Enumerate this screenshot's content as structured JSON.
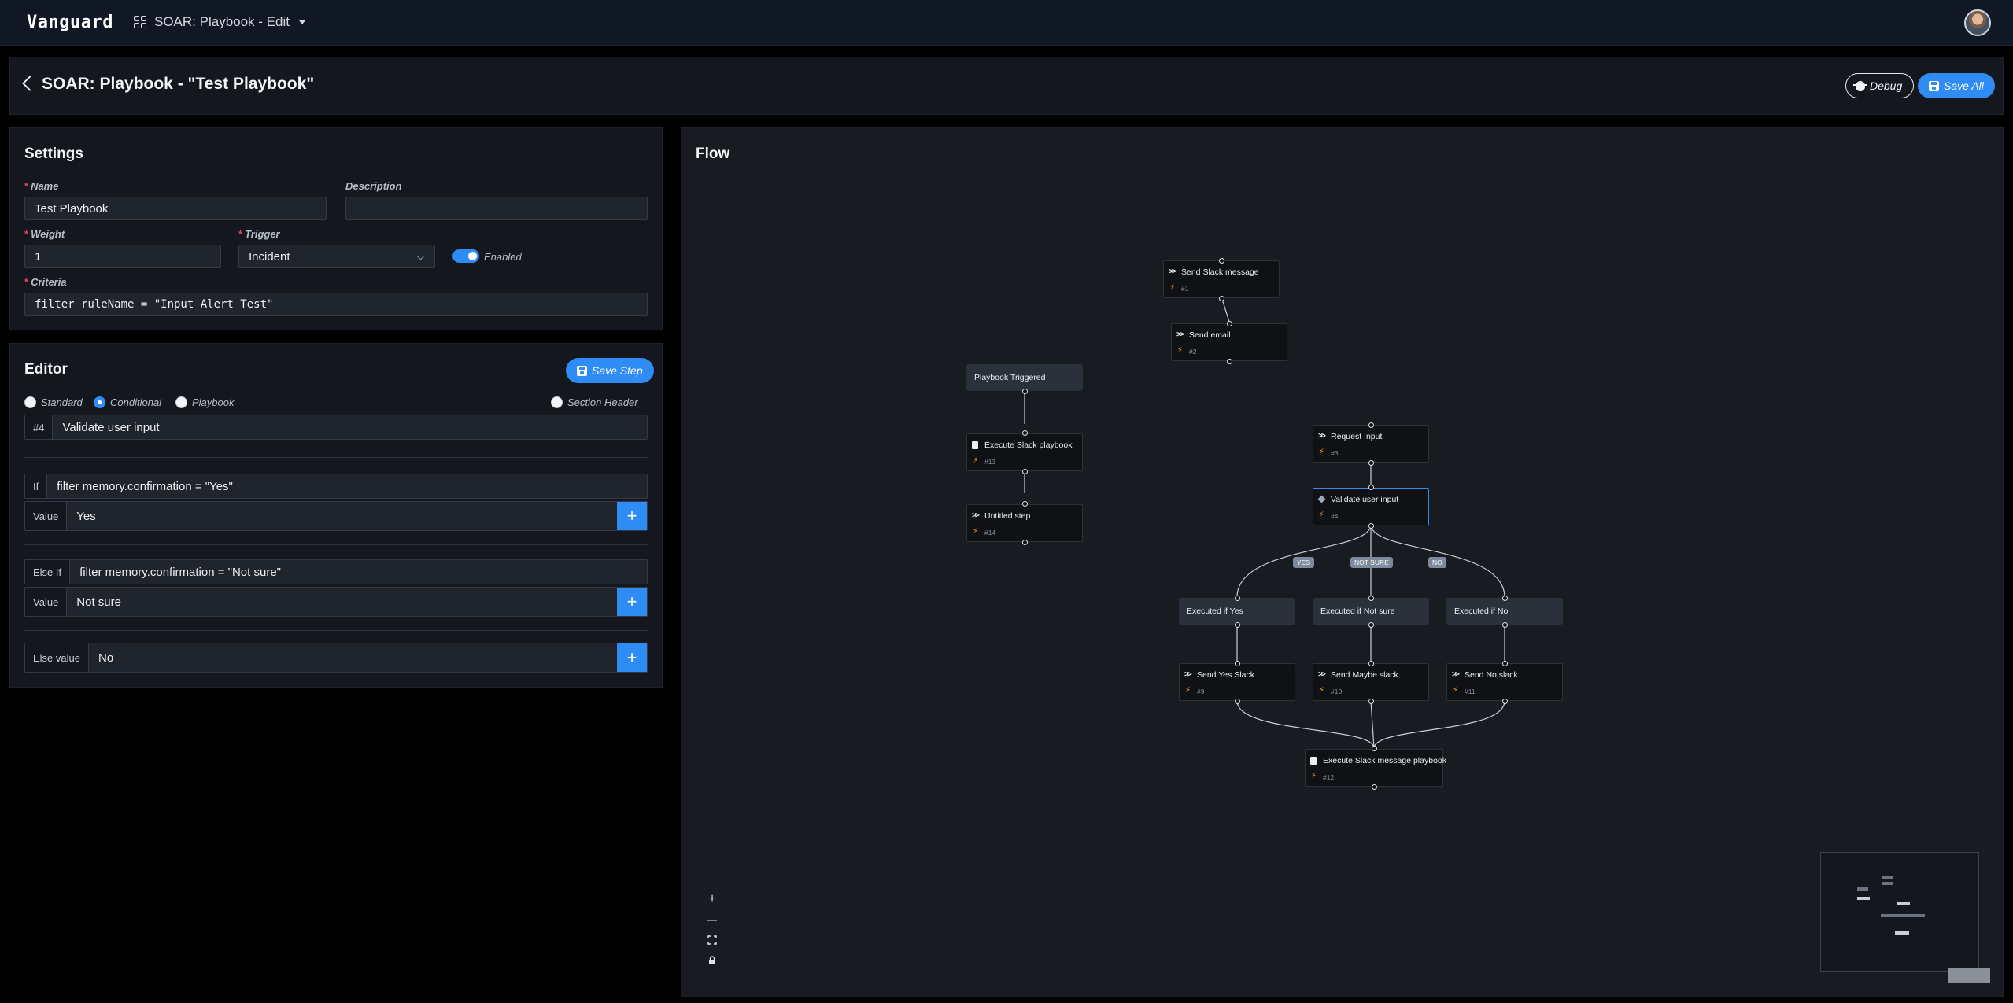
{
  "app": {
    "brand": "Vanguard",
    "nav_label": "SOAR: Playbook - Edit"
  },
  "header": {
    "title": "SOAR: Playbook - \"Test Playbook\"",
    "debug_label": "Debug",
    "save_all_label": "Save All"
  },
  "settings": {
    "title": "Settings",
    "name_label": "Name",
    "name_value": "Test Playbook",
    "description_label": "Description",
    "description_value": "",
    "weight_label": "Weight",
    "weight_value": "1",
    "trigger_label": "Trigger",
    "trigger_value": "Incident",
    "enabled_label": "Enabled",
    "enabled": true,
    "criteria_label": "Criteria",
    "criteria_value": "filter ruleName = \"Input Alert Test\""
  },
  "editor": {
    "title": "Editor",
    "save_step_label": "Save Step",
    "step_types": [
      "Standard",
      "Conditional",
      "Playbook"
    ],
    "selected_type": "Conditional",
    "section_header_label": "Section Header",
    "step_id": "#4",
    "step_name": "Validate user input",
    "if_label": "If",
    "if_filter": "filter memory.confirmation = \"Yes\"",
    "value_label": "Value",
    "if_value": "Yes",
    "elseif_label": "Else If",
    "elseif_filter": "filter memory.confirmation = \"Not sure\"",
    "elseif_value": "Not sure",
    "else_label": "Else value",
    "else_value": "No"
  },
  "flow": {
    "title": "Flow",
    "nodes": {
      "n1": {
        "label": "Send Slack message",
        "id": "#1"
      },
      "n2": {
        "label": "Send email",
        "id": "#2"
      },
      "trig": {
        "label": "Playbook Triggered"
      },
      "n13": {
        "label": "Execute Slack playbook",
        "id": "#13"
      },
      "n14": {
        "label": "Untitled step",
        "id": "#14"
      },
      "n3": {
        "label": "Request Input",
        "id": "#3"
      },
      "n4": {
        "label": "Validate user input",
        "id": "#4"
      },
      "g_yes": {
        "label": "Executed if Yes"
      },
      "g_ns": {
        "label": "Executed if Not sure"
      },
      "g_no": {
        "label": "Executed if No"
      },
      "n9": {
        "label": "Send Yes Slack",
        "id": "#9"
      },
      "n10": {
        "label": "Send Maybe slack",
        "id": "#10"
      },
      "n11": {
        "label": "Send No slack",
        "id": "#11"
      },
      "n12": {
        "label": "Execute Slack message playbook",
        "id": "#12"
      }
    },
    "edge_labels": {
      "yes": "YES",
      "not_sure": "NOT SURE",
      "no": "NO"
    },
    "controls": {
      "zoom_in": "+",
      "zoom_out": "—"
    }
  }
}
